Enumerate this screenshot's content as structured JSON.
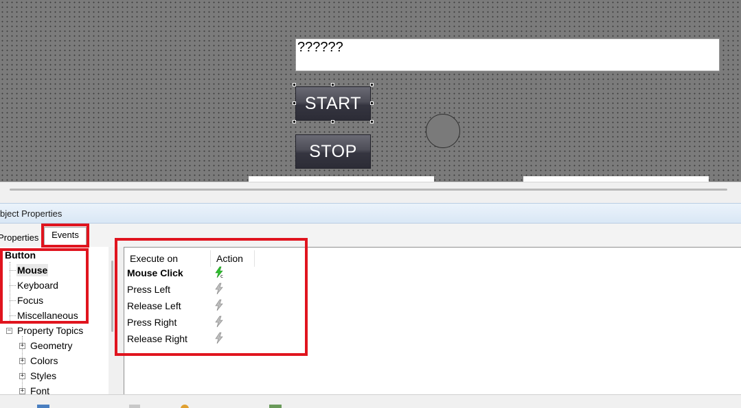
{
  "canvas": {
    "text_field_value": "??????",
    "start_button_label": "START",
    "stop_button_label": "STOP"
  },
  "panel": {
    "title": "bject Properties",
    "tabs": [
      {
        "label": "Properties",
        "active": false
      },
      {
        "label": "Events",
        "active": true
      }
    ]
  },
  "tree": {
    "root": "Button",
    "event_groups": [
      "Mouse",
      "Keyboard",
      "Focus",
      "Miscellaneous"
    ],
    "selected": "Mouse",
    "property_topics_label": "Property Topics",
    "property_topics": [
      "Geometry",
      "Colors",
      "Styles",
      "Font"
    ]
  },
  "events_grid": {
    "headers": {
      "execute_on": "Execute on",
      "action": "Action"
    },
    "rows": [
      {
        "label": "Mouse Click",
        "configured": true
      },
      {
        "label": "Press Left",
        "configured": false
      },
      {
        "label": "Release Left",
        "configured": false
      },
      {
        "label": "Press Right",
        "configured": false
      },
      {
        "label": "Release Right",
        "configured": false
      }
    ]
  },
  "icons": {
    "action_configured": "lightning-bolt-green-icon",
    "action_empty": "lightning-bolt-gray-icon",
    "tree_expand": "plus-box-icon",
    "tree_collapse": "minus-box-icon"
  },
  "colors": {
    "canvas_background": "#7b7b7b",
    "annotation_red": "#e0141e",
    "bolt_green": "#2fbf2f",
    "bolt_gray": "#9a9a9a"
  }
}
